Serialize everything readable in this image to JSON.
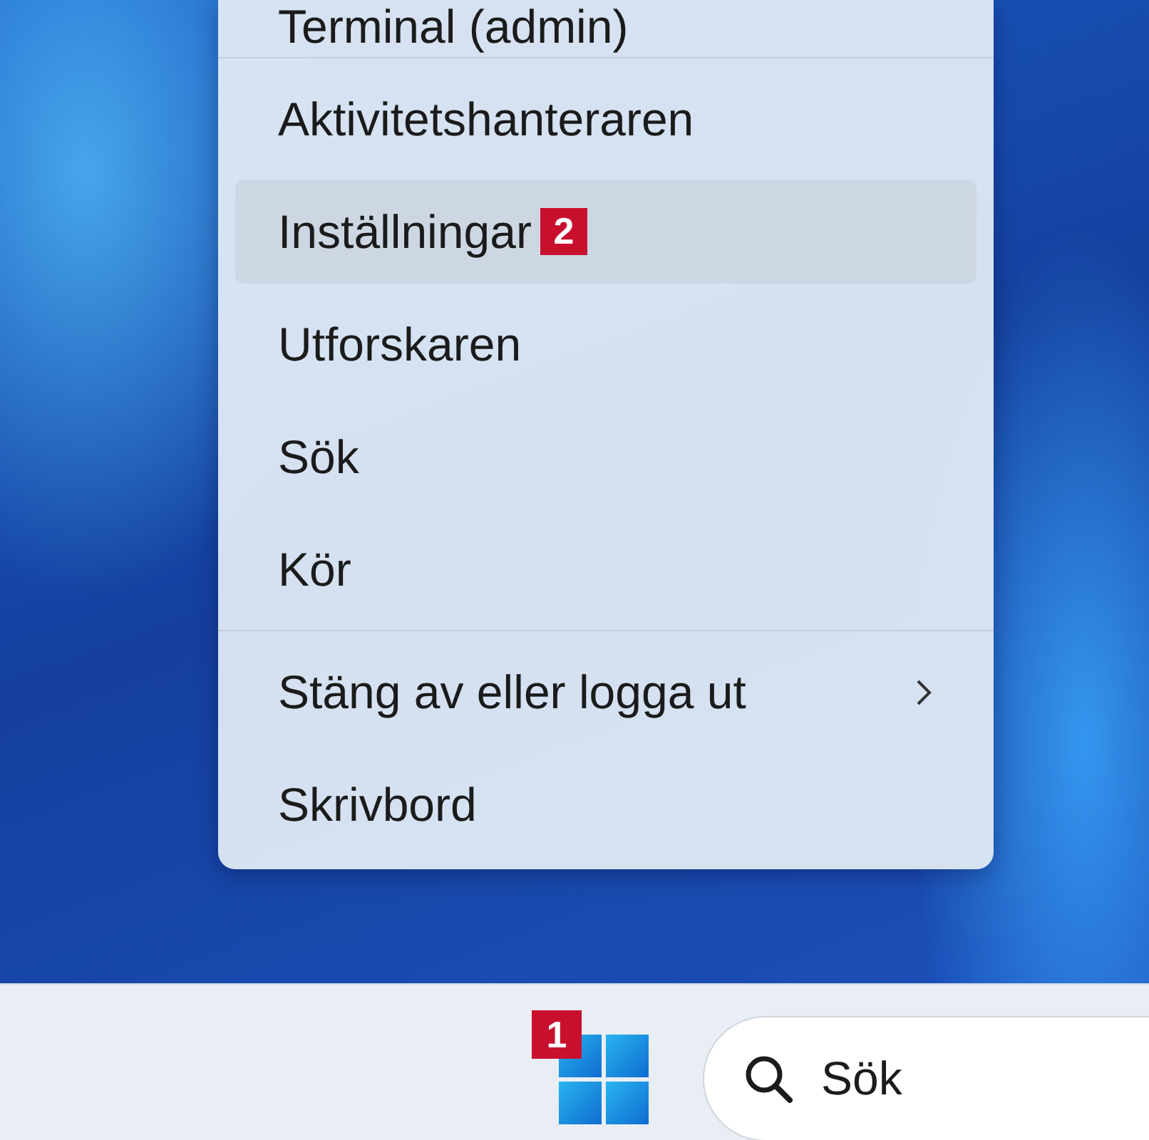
{
  "menu": {
    "items": [
      {
        "kind": "item",
        "label": "Terminal (admin)",
        "selected": false
      },
      {
        "kind": "separator"
      },
      {
        "kind": "item",
        "label": "Aktivitetshanteraren",
        "selected": false
      },
      {
        "kind": "item",
        "label": "Inställningar",
        "selected": true,
        "badge": "2"
      },
      {
        "kind": "item",
        "label": "Utforskaren",
        "selected": false
      },
      {
        "kind": "item",
        "label": "Sök",
        "selected": false
      },
      {
        "kind": "item",
        "label": "Kör",
        "selected": false
      },
      {
        "kind": "separator"
      },
      {
        "kind": "submenu",
        "label": "Stäng av eller logga ut",
        "selected": false
      },
      {
        "kind": "item",
        "label": "Skrivbord",
        "selected": false
      }
    ]
  },
  "taskbar": {
    "start_badge": "1",
    "search": {
      "placeholder": "Sök"
    }
  }
}
